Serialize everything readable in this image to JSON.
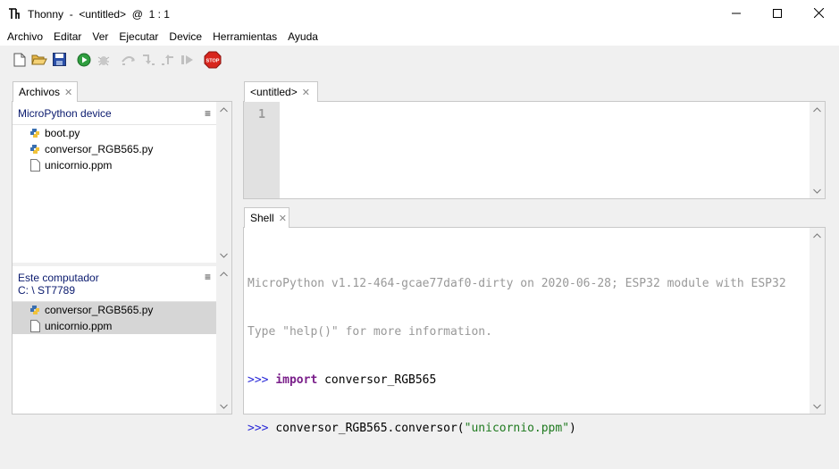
{
  "window": {
    "title": "Thonny  -  <untitled>  @  1 : 1",
    "controls": [
      "minimize-icon",
      "maximize-icon",
      "close-icon"
    ]
  },
  "menu": [
    "Archivo",
    "Editar",
    "Ver",
    "Ejecutar",
    "Device",
    "Herramientas",
    "Ayuda"
  ],
  "toolbar": {
    "buttons": [
      {
        "name": "new-file",
        "icon": "new-file-icon"
      },
      {
        "name": "open-file",
        "icon": "open-folder-icon"
      },
      {
        "name": "save-file",
        "icon": "save-icon"
      },
      {
        "name": "run",
        "icon": "run-icon"
      },
      {
        "name": "debug",
        "icon": "debug-icon"
      },
      {
        "name": "step-over",
        "icon": "step-over-icon"
      },
      {
        "name": "step-into",
        "icon": "step-into-icon"
      },
      {
        "name": "step-out",
        "icon": "step-out-icon"
      },
      {
        "name": "resume",
        "icon": "resume-icon"
      },
      {
        "name": "stop",
        "icon": "stop-icon",
        "label": "STOP"
      }
    ]
  },
  "files": {
    "tab_label": "Archivos",
    "device": {
      "title": "MicroPython device",
      "items": [
        {
          "name": "boot.py",
          "type": "python"
        },
        {
          "name": "conversor_RGB565.py",
          "type": "python"
        },
        {
          "name": "unicornio.ppm",
          "type": "file"
        }
      ]
    },
    "computer": {
      "title": "Este computador",
      "path": "C: \\ ST7789",
      "items": [
        {
          "name": "conversor_RGB565.py",
          "type": "python"
        },
        {
          "name": "unicornio.ppm",
          "type": "file"
        }
      ]
    }
  },
  "editor": {
    "tab_label": "<untitled>",
    "line_numbers": [
      "1"
    ]
  },
  "shell": {
    "tab_label": "Shell",
    "banner_line1": "MicroPython v1.12-464-gcae77daf0-dirty on 2020-06-28; ESP32 module with ESP32",
    "banner_line2": "Type \"help()\" for more information.",
    "prompt": ">>> ",
    "cmd1_keyword": "import",
    "cmd1_rest": " conversor_RGB565",
    "cmd2_before": "conversor_RGB565.conversor(",
    "cmd2_string": "\"unicornio.ppm\"",
    "cmd2_after": ")"
  },
  "colors": {
    "section_title": "#0a1a6e",
    "prompt": "#2a2ad8",
    "keyword": "#7a1f8a",
    "string": "#1f7a1f",
    "banner": "#999999",
    "gutter": "#e1e1e1",
    "selected_row": "#d6d6d6"
  }
}
